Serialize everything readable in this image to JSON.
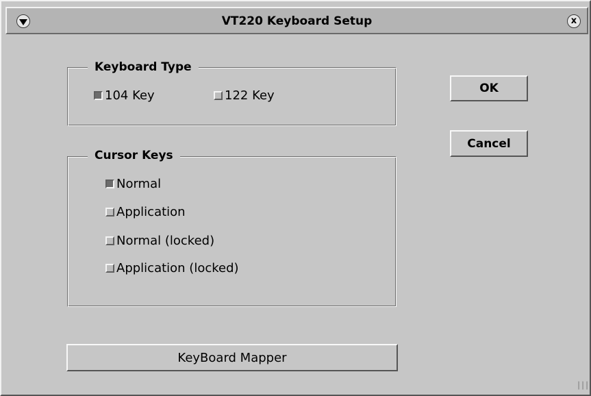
{
  "window": {
    "title": "VT220 Keyboard Setup",
    "menu_icon": "down-triangle-icon",
    "close_icon": "close-x-icon",
    "close_glyph": "x"
  },
  "keyboard_type": {
    "label": "Keyboard Type",
    "options": [
      {
        "label": "104 Key",
        "checked": true
      },
      {
        "label": "122 Key",
        "checked": false
      }
    ]
  },
  "cursor_keys": {
    "label": "Cursor Keys",
    "options": [
      {
        "label": "Normal",
        "checked": true
      },
      {
        "label": "Application",
        "checked": false
      },
      {
        "label": "Normal (locked)",
        "checked": false
      },
      {
        "label": "Application (locked)",
        "checked": false
      }
    ]
  },
  "buttons": {
    "ok": "OK",
    "cancel": "Cancel",
    "mapper": "KeyBoard Mapper"
  },
  "colors": {
    "background": "#c6c6c6",
    "titlebar": "#b4b4b4",
    "checked_fill": "#6c6c6c"
  }
}
